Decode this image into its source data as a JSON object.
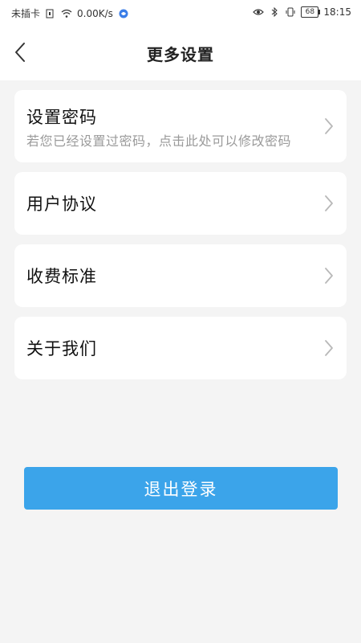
{
  "status_bar": {
    "carrier": "未插卡",
    "speed": "0.00K/s",
    "battery": "68",
    "time": "18:15"
  },
  "header": {
    "title": "更多设置",
    "back_icon": "chevron-left-icon"
  },
  "menu": {
    "items": [
      {
        "label": "设置密码",
        "desc": "若您已经设置过密码，点击此处可以修改密码"
      },
      {
        "label": "用户协议"
      },
      {
        "label": "收费标准"
      },
      {
        "label": "关于我们"
      }
    ]
  },
  "logout": {
    "label": "退出登录"
  },
  "colors": {
    "accent": "#3ba4ea",
    "background": "#f4f4f4"
  }
}
